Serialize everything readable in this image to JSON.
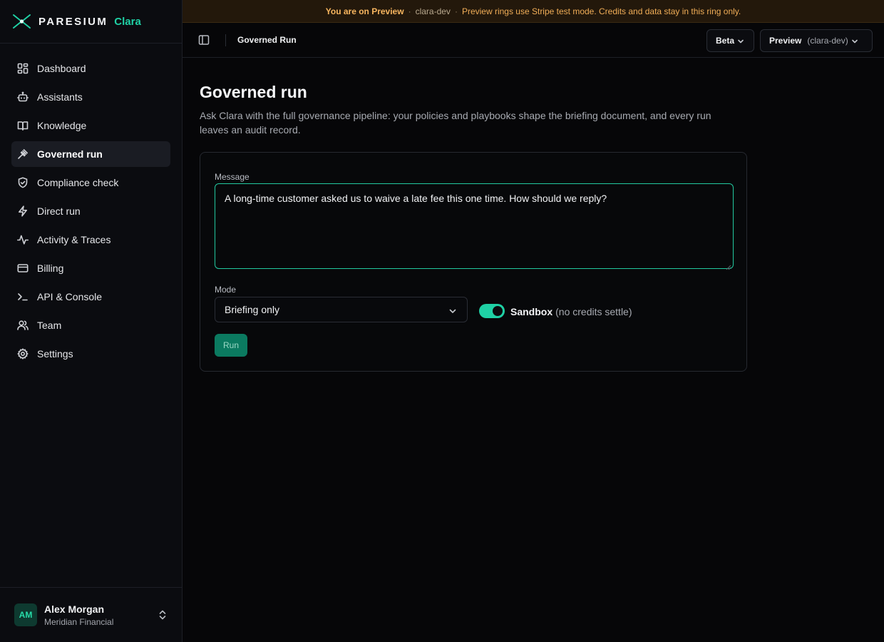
{
  "brand": {
    "name": "PARESIUM",
    "product": "Clara"
  },
  "banner": {
    "prefix": "You are on Preview",
    "sep1": "·",
    "ring": "clara-dev",
    "sep2": "·",
    "message": "Preview rings use Stripe test mode. Credits and data stay in this ring only."
  },
  "nav": {
    "items": [
      {
        "label": "Dashboard",
        "icon": "dashboard-icon"
      },
      {
        "label": "Assistants",
        "icon": "bot-icon"
      },
      {
        "label": "Knowledge",
        "icon": "book-icon"
      },
      {
        "label": "Governed run",
        "icon": "gavel-icon",
        "active": true
      },
      {
        "label": "Compliance check",
        "icon": "shield-check-icon"
      },
      {
        "label": "Direct run",
        "icon": "bolt-icon"
      },
      {
        "label": "Activity & Traces",
        "icon": "activity-icon"
      },
      {
        "label": "Billing",
        "icon": "card-icon"
      },
      {
        "label": "API & Console",
        "icon": "terminal-icon"
      },
      {
        "label": "Team",
        "icon": "users-icon"
      },
      {
        "label": "Settings",
        "icon": "gear-icon"
      }
    ]
  },
  "user": {
    "initials": "AM",
    "name": "Alex Morgan",
    "org": "Meridian Financial"
  },
  "topbar": {
    "breadcrumb": "Governed Run",
    "beta_label": "Beta",
    "env_label": "Preview",
    "env_ring": "(clara-dev)"
  },
  "page": {
    "title": "Governed run",
    "description": "Ask Clara with the full governance pipeline: your policies and playbooks shape the briefing document, and every run leaves an audit record."
  },
  "form": {
    "message_label": "Message",
    "message_value": "A long-time customer asked us to waive a late fee this one time. How should we reply?",
    "mode_label": "Mode",
    "mode_value": "Briefing only",
    "sandbox_label": "Sandbox",
    "sandbox_hint": "(no credits settle)",
    "sandbox_on": true,
    "run_label": "Run"
  },
  "colors": {
    "accent": "#1fd1a5",
    "banner_text": "#f0ad57",
    "background": "#060608"
  }
}
